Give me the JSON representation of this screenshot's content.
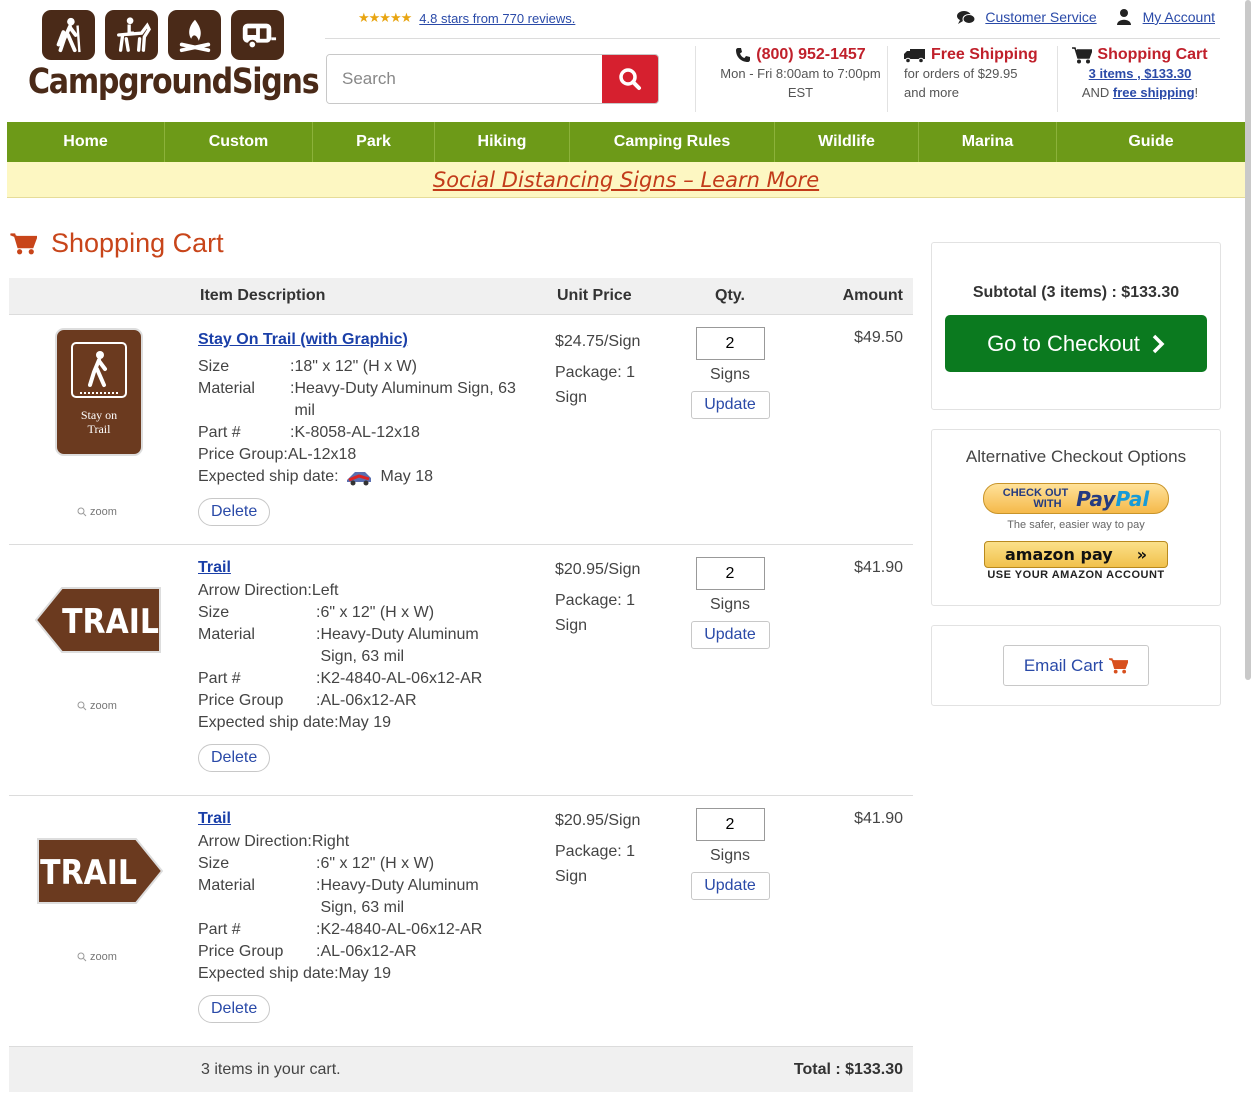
{
  "header": {
    "logo_text": "CampgroundSigns",
    "rating_stars": "★★★★★",
    "rating_text": "4.8 stars from 770 reviews.",
    "customer_service": "Customer Service",
    "my_account": "My Account",
    "search_placeholder": "Search",
    "phone": "(800) 952-1457",
    "phone_hours": "Mon - Fri 8:00am to 7:00pm EST",
    "shipping_title": "Free Shipping",
    "shipping_sub": "for orders of $29.95 and more",
    "cart_title": "Shopping Cart",
    "cart_summary": "3 items , $133.30",
    "cart_and": "AND",
    "cart_free": "free shipping",
    "cart_bang": "!"
  },
  "nav": {
    "items": [
      "Home",
      "Custom",
      "Park",
      "Hiking",
      "Camping Rules",
      "Wildlife",
      "Marina",
      "Guide"
    ]
  },
  "banner": {
    "link_text": "Social Distancing Signs",
    "sep": " – ",
    "learn": "Learn More"
  },
  "cart": {
    "title": "Shopping Cart",
    "columns": {
      "description": "Item Description",
      "unit_price": "Unit Price",
      "qty": "Qty.",
      "amount": "Amount"
    },
    "zoom_label": "zoom",
    "delete_label": "Delete",
    "update_label": "Update",
    "items": [
      {
        "title": "Stay On Trail (with Graphic)",
        "sign_text_line1": "Stay on",
        "sign_text_line2": "Trail",
        "attrs": [
          {
            "label": "Size",
            "sep": ": ",
            "value": "18\" x 12\" (H x W)"
          },
          {
            "label": "Material",
            "sep": ": ",
            "value": "Heavy-Duty Aluminum Sign, 63 mil"
          },
          {
            "label": "Part #",
            "sep": ": ",
            "value": "K-8058-AL-12x18"
          },
          {
            "label": "Price Group",
            "sep": ": ",
            "value": "AL-12x18"
          },
          {
            "label": "Expected ship date",
            "sep": ": ",
            "value": "May 18"
          }
        ],
        "unit_price": "$24.75/Sign",
        "package": "Package: 1 Sign",
        "qty": "2",
        "qty_unit": "Signs",
        "amount": "$49.50"
      },
      {
        "title": "Trail",
        "sign_text": "TRAIL",
        "attrs": [
          {
            "label": "Arrow Direction",
            "sep": ": ",
            "value": "Left"
          },
          {
            "label": "Size",
            "sep": ": ",
            "value": "6\" x 12\" (H x W)"
          },
          {
            "label": "Material",
            "sep": ": ",
            "value": "Heavy-Duty Aluminum Sign, 63 mil"
          },
          {
            "label": "Part #",
            "sep": ": ",
            "value": "K2-4840-AL-06x12-AR"
          },
          {
            "label": "Price Group",
            "sep": ": ",
            "value": "AL-06x12-AR"
          },
          {
            "label": "Expected ship date",
            "sep": ": ",
            "value": "May 19"
          }
        ],
        "unit_price": "$20.95/Sign",
        "package": "Package: 1 Sign",
        "qty": "2",
        "qty_unit": "Signs",
        "amount": "$41.90"
      },
      {
        "title": "Trail",
        "sign_text": "TRAIL",
        "attrs": [
          {
            "label": "Arrow Direction",
            "sep": ": ",
            "value": "Right"
          },
          {
            "label": "Size",
            "sep": ": ",
            "value": "6\" x 12\" (H x W)"
          },
          {
            "label": "Material",
            "sep": ": ",
            "value": "Heavy-Duty Aluminum Sign, 63 mil"
          },
          {
            "label": "Part #",
            "sep": ": ",
            "value": "K2-4840-AL-06x12-AR"
          },
          {
            "label": "Price Group",
            "sep": ": ",
            "value": "AL-06x12-AR"
          },
          {
            "label": "Expected ship date",
            "sep": ": ",
            "value": "May 19"
          }
        ],
        "unit_price": "$20.95/Sign",
        "package": "Package: 1 Sign",
        "qty": "2",
        "qty_unit": "Signs",
        "amount": "$41.90"
      }
    ],
    "footer_count": "3 items in your cart.",
    "footer_total": "Total : $133.30"
  },
  "sidebar": {
    "subtotal": "Subtotal (3 items) : $133.30",
    "checkout_label": "Go to Checkout",
    "alt_title": "Alternative Checkout Options",
    "paypal_check": "CHECK OUT",
    "paypal_with": "WITH",
    "paypal_pay": "Pay",
    "paypal_pal": "Pal",
    "paypal_tagline": "The safer, easier way to pay",
    "amazon_label": "amazon pay",
    "amazon_arrows": "»",
    "amazon_tagline": "USE YOUR AMAZON ACCOUNT",
    "email_label": "Email Cart"
  },
  "colors": {
    "brand_brown": "#4a2a18",
    "nav_green": "#6d9a18",
    "accent_red": "#c0202b",
    "checkout_green": "#0b7a1f",
    "link_blue": "#1a3fa8"
  },
  "icons": [
    "hiker-icon",
    "horse-rider-icon",
    "campfire-icon",
    "rv-trailer-icon",
    "chat-icon",
    "user-icon",
    "phone-icon",
    "truck-icon",
    "cart-icon",
    "search-icon",
    "zoom-icon",
    "chevron-right-icon",
    "ship-truck-icon"
  ]
}
